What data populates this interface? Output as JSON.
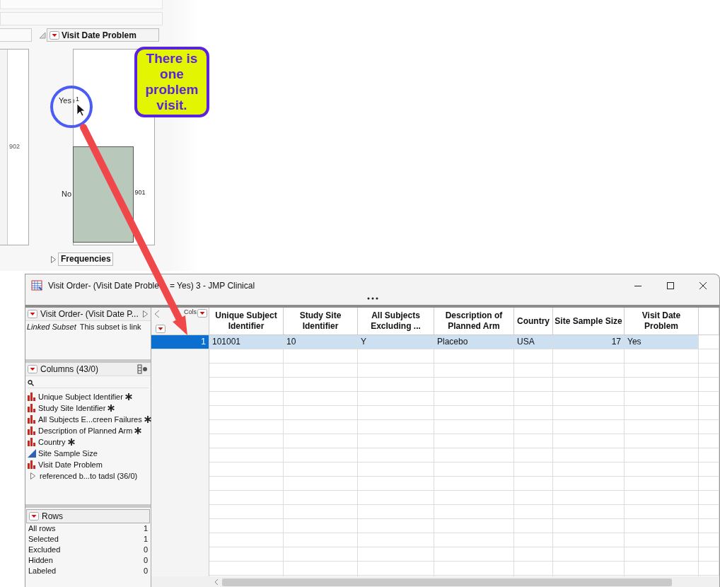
{
  "report": {
    "outline_title": "Visit Date Problem",
    "side_chart_label": "902",
    "chart_data": {
      "type": "bar",
      "orientation": "horizontal",
      "categories": [
        "Yes",
        "No"
      ],
      "values": [
        1,
        901
      ],
      "data_labels": true
    },
    "frequencies": {
      "label": "Frequencies",
      "expanded": false
    }
  },
  "callout": {
    "text": "There is one problem visit."
  },
  "window": {
    "title_start": "Visit Order- (Visit Date Proble",
    "title_end": "= Yes) 3 - JMP Clinical"
  },
  "table_panel": {
    "title": "Visit Order- (Visit Date P...",
    "property": "Linked Subset",
    "note": "This subset is link"
  },
  "columns_panel": {
    "title": "Columns (43/0)",
    "items": [
      {
        "name": "Unique Subject Identifier",
        "kind": "nominal",
        "key": true
      },
      {
        "name": "Study Site Identifier",
        "kind": "nominal",
        "key": true
      },
      {
        "name": "All Subjects E...creen Failures",
        "kind": "nominal",
        "key": true
      },
      {
        "name": "Description of Planned Arm",
        "kind": "nominal",
        "key": true
      },
      {
        "name": "Country",
        "kind": "nominal",
        "key": true
      },
      {
        "name": "Site Sample Size",
        "kind": "continuous",
        "key": false
      },
      {
        "name": "Visit Date Problem",
        "kind": "nominal",
        "key": false
      }
    ],
    "group": {
      "label": "referenced b...to tadsl (36/0)",
      "expanded": false
    }
  },
  "rows_panel": {
    "title": "Rows",
    "rows": [
      {
        "label": "All rows",
        "count": "1"
      },
      {
        "label": "Selected",
        "count": "1"
      },
      {
        "label": "Excluded",
        "count": "0"
      },
      {
        "label": "Hidden",
        "count": "0"
      },
      {
        "label": "Labeled",
        "count": "0"
      }
    ]
  },
  "table": {
    "corner": "Cols",
    "columns": [
      {
        "label": "Unique Subject Identifier",
        "kind": "nominal"
      },
      {
        "label": "Study Site Identifier",
        "kind": "nominal"
      },
      {
        "label": "All Subjects Excluding ...",
        "kind": "nominal"
      },
      {
        "label": "Description of Planned Arm",
        "kind": "nominal"
      },
      {
        "label": "Country",
        "kind": "nominal"
      },
      {
        "label": "Site Sample Size",
        "kind": "continuous"
      },
      {
        "label": "Visit Date Problem",
        "kind": "nominal"
      }
    ],
    "rows": [
      {
        "number": "1",
        "selected": true,
        "cells": [
          "101001",
          "10",
          "Y",
          "Placebo",
          "USA",
          "17",
          "Yes"
        ]
      }
    ]
  }
}
